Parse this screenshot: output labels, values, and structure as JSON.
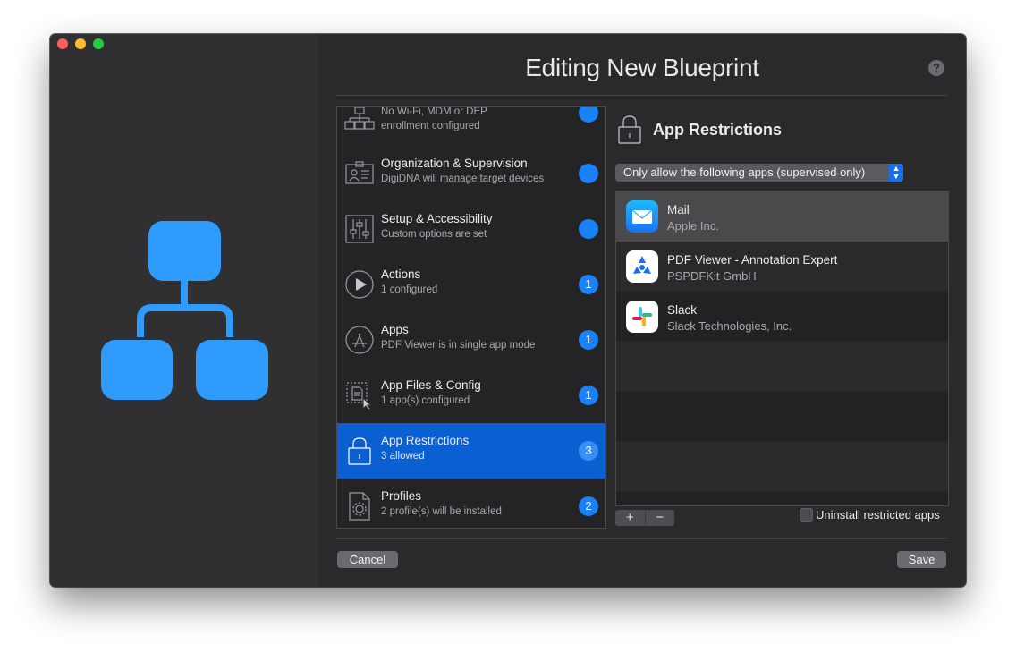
{
  "window": {
    "title": "Editing New Blueprint",
    "help": "?"
  },
  "sections": [
    {
      "name": "",
      "desc_line1": "No Wi-Fi, MDM or DEP",
      "desc_line2": "enrollment configured",
      "badge": "",
      "icon": "network-hierarchy-icon"
    },
    {
      "name": "Organization & Supervision",
      "desc": "DigiDNA will manage target devices",
      "badge": "",
      "icon": "id-card-icon"
    },
    {
      "name": "Setup & Accessibility",
      "desc": "Custom options are set",
      "badge": "",
      "icon": "sliders-icon"
    },
    {
      "name": "Actions",
      "desc": "1 configured",
      "badge": "1",
      "icon": "play-icon"
    },
    {
      "name": "Apps",
      "desc": "PDF Viewer is in single app mode",
      "badge": "1",
      "icon": "app-store-icon"
    },
    {
      "name": "App Files & Config",
      "desc": "1 app(s) configured",
      "badge": "1",
      "icon": "app-files-icon"
    },
    {
      "name": "App Restrictions",
      "desc": "3 allowed",
      "badge": "3",
      "icon": "lock-icon"
    },
    {
      "name": "Profiles",
      "desc": "2 profile(s) will be installed",
      "badge": "2",
      "icon": "profile-gear-icon"
    }
  ],
  "restrictions": {
    "title": "App Restrictions",
    "mode": "Only allow the following apps (supervised only)",
    "apps": [
      {
        "name": "Mail",
        "vendor": "Apple Inc.",
        "icon": "mail-icon"
      },
      {
        "name": "PDF Viewer - Annotation Expert",
        "vendor": "PSPDFKit GmbH",
        "icon": "pdf-viewer-icon"
      },
      {
        "name": "Slack",
        "vendor": "Slack Technologies, Inc.",
        "icon": "slack-icon"
      }
    ],
    "add": "+",
    "remove": "−",
    "uninstall_label": "Uninstall restricted apps"
  },
  "footer": {
    "cancel": "Cancel",
    "save": "Save"
  },
  "colors": {
    "accent": "#1a81f6",
    "selection": "#0a5fd1",
    "hero": "#2f9bfd"
  }
}
